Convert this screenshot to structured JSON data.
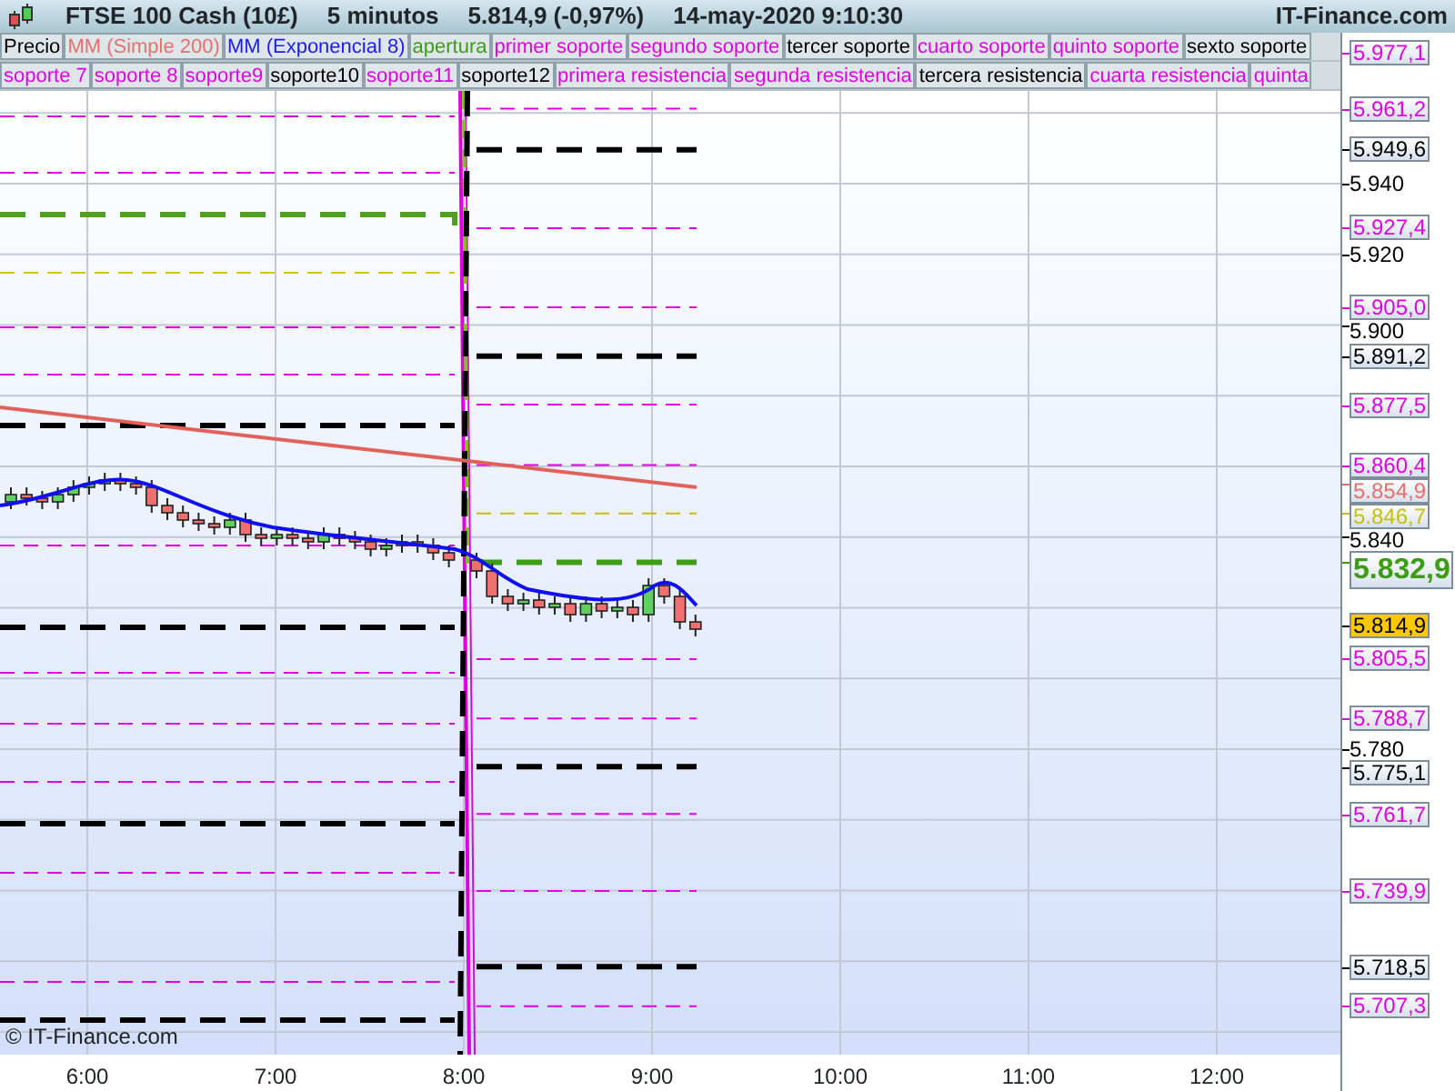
{
  "title_bar": {
    "instrument": "FTSE 100 Cash (10£)",
    "timeframe": "5 minutos",
    "quote": "5.814,9 (-0,97%)",
    "datetime": "14-may-2020 9:10:30",
    "site": "IT-Finance.com"
  },
  "legend_rows": [
    [
      {
        "label": "Precio",
        "color": "#000000"
      },
      {
        "label": "MM (Simple 200)",
        "color": "#e8706a"
      },
      {
        "label": "MM (Exponencial 8)",
        "color": "#1a1aff"
      },
      {
        "label": "apertura",
        "color": "#3c9c14"
      },
      {
        "label": "primer soporte",
        "color": "#e000e0"
      },
      {
        "label": "segundo soporte",
        "color": "#e000e0"
      },
      {
        "label": "tercer soporte",
        "color": "#000000"
      },
      {
        "label": "cuarto soporte",
        "color": "#e000e0"
      },
      {
        "label": "quinto soporte",
        "color": "#e000e0"
      },
      {
        "label": "sexto soporte",
        "color": "#000000"
      }
    ],
    [
      {
        "label": "soporte 7",
        "color": "#e000e0"
      },
      {
        "label": "soporte 8",
        "color": "#e000e0"
      },
      {
        "label": "soporte9",
        "color": "#e000e0"
      },
      {
        "label": "soporte10",
        "color": "#000000"
      },
      {
        "label": "soporte11",
        "color": "#e000e0"
      },
      {
        "label": "soporte12",
        "color": "#000000"
      },
      {
        "label": "primera resistencia",
        "color": "#e000e0"
      },
      {
        "label": "segunda resistencia",
        "color": "#e000e0"
      },
      {
        "label": "tercera resistencia",
        "color": "#000000"
      },
      {
        "label": "cuarta resistencia",
        "color": "#e000e0"
      },
      {
        "label": "quinta",
        "color": "#e000e0"
      }
    ]
  ],
  "price_axis": [
    {
      "text": "5.977,1",
      "kind": "thin-level",
      "color": "#e000e0"
    },
    {
      "text": "5.961,2",
      "kind": "thin-level",
      "color": "#e000e0"
    },
    {
      "text": "5.949,6",
      "kind": "thick-level",
      "color": "#000000"
    },
    {
      "text": "5.940",
      "kind": "tick",
      "color": "#000000"
    },
    {
      "text": "5.927,4",
      "kind": "thin-level",
      "color": "#e000e0"
    },
    {
      "text": "5.920",
      "kind": "tick",
      "color": "#000000"
    },
    {
      "text": "5.905,0",
      "kind": "thin-level",
      "color": "#e000e0"
    },
    {
      "text": "5.900",
      "kind": "tick",
      "color": "#000000"
    },
    {
      "text": "5.891,2",
      "kind": "thick-level",
      "color": "#000000"
    },
    {
      "text": "5.877,5",
      "kind": "thin-level",
      "color": "#e000e0"
    },
    {
      "text": "5.860,4",
      "kind": "thin-level",
      "color": "#e000e0"
    },
    {
      "text": "5.854,9",
      "kind": "average",
      "color": "#e8706a"
    },
    {
      "text": "5.846,7",
      "kind": "thin-level",
      "color": "#c8c000"
    },
    {
      "text": "5.840",
      "kind": "tick",
      "color": "#000000"
    },
    {
      "text": "5.832,9",
      "kind": "open",
      "color": "#3c9c14"
    },
    {
      "text": "5.814,9",
      "kind": "last"
    },
    {
      "text": "5.805,5",
      "kind": "thin-level",
      "color": "#e000e0"
    },
    {
      "text": "5.788,7",
      "kind": "thin-level",
      "color": "#e000e0"
    },
    {
      "text": "5.780",
      "kind": "tick",
      "color": "#000000"
    },
    {
      "text": "5.775,1",
      "kind": "thick-level",
      "color": "#000000"
    },
    {
      "text": "5.761,7",
      "kind": "thin-level",
      "color": "#e000e0"
    },
    {
      "text": "5.739,9",
      "kind": "thin-level",
      "color": "#e000e0"
    },
    {
      "text": "5.718,5",
      "kind": "thick-level",
      "color": "#000000"
    },
    {
      "text": "5.707,3",
      "kind": "thin-level",
      "color": "#e000e0"
    }
  ],
  "time_axis": [
    "6:00",
    "7:00",
    "8:00",
    "9:00",
    "10:00",
    "11:00",
    "12:00"
  ],
  "copyright": "© IT-Finance.com"
}
